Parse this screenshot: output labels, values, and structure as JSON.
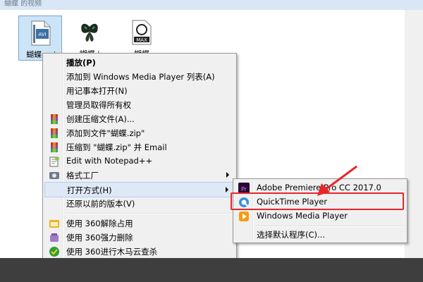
{
  "window": {
    "title_fragment": "蝴蝶 的视频"
  },
  "files": [
    {
      "name": "蝴蝶.avi",
      "badge": "AVI",
      "selected": true
    },
    {
      "name": "蝴蝶.j",
      "badge": "",
      "selected": false
    },
    {
      "name": "蝴蝶",
      "badge": "MAX",
      "selected": false
    }
  ],
  "context_menu": {
    "items": [
      {
        "label": "播放(P)",
        "bold": true,
        "icon": ""
      },
      {
        "label": "添加到 Windows Media Player 列表(A)",
        "icon": ""
      },
      {
        "label": "用记事本打开(N)",
        "icon": ""
      },
      {
        "label": "管理员取得所有权",
        "icon": ""
      },
      {
        "label": "创建压缩文件(A)...",
        "icon": "winrar-icon"
      },
      {
        "label": "添加到文件\"蝴蝶.zip\"",
        "icon": "winrar-icon"
      },
      {
        "label": "压缩到 \"蝴蝶.zip\" 并 Email",
        "icon": "winrar-icon"
      },
      {
        "label": "Edit with Notepad++",
        "icon": "notepad-plus-plus-icon"
      },
      {
        "label": "格式工厂",
        "icon": "format-factory-icon",
        "submenu": true
      },
      {
        "label": "打开方式(H)",
        "icon": "",
        "submenu": true,
        "highlighted": true
      },
      {
        "label": "还原以前的版本(V)",
        "icon": ""
      },
      {
        "label": "使用 360解除占用",
        "icon": "360-unlock-icon"
      },
      {
        "label": "使用 360强力删除",
        "icon": "360-delete-icon"
      },
      {
        "label": "使用 360进行木马云查杀",
        "icon": "360-scan-icon"
      }
    ]
  },
  "open_with_submenu": {
    "items": [
      {
        "label": "Adobe Premiere Pro CC 2017.0",
        "icon": "premiere-icon"
      },
      {
        "label": "QuickTime Player",
        "icon": "quicktime-icon",
        "highlighted": true
      },
      {
        "label": "Windows Media Player",
        "icon": "wmp-icon"
      },
      {
        "label": "选择默认程序(C)...",
        "icon": ""
      }
    ]
  },
  "colors": {
    "highlight_box": "#e8262a",
    "menu_bg": "#f0f0f0",
    "selection": "#cce4f7"
  }
}
